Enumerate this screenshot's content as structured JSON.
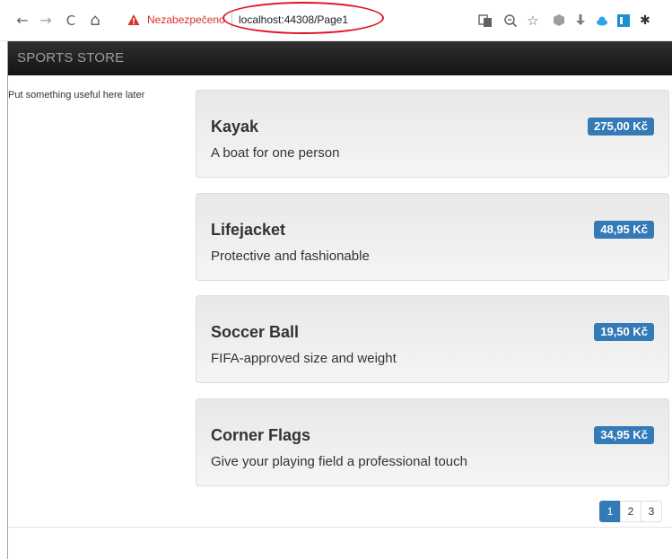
{
  "browser": {
    "back_icon": "←",
    "forward_icon": "→",
    "reload_icon": "C",
    "home_icon": "⌂",
    "security_label": "Nezabezpečeno",
    "url": "localhost:44308/Page1",
    "icons": [
      "translate-icon",
      "zoom-icon",
      "star-icon",
      "extension-icon",
      "download-icon",
      "cloud-icon",
      "profile-icon",
      "puzzle-icon"
    ],
    "annotation_color": "#e0131f"
  },
  "navbar": {
    "brand": "SPORTS STORE"
  },
  "sidebar": {
    "note": "Put something useful here later"
  },
  "products": [
    {
      "name": "Kayak",
      "description": "A boat for one person",
      "price": "275,00 Kč"
    },
    {
      "name": "Lifejacket",
      "description": "Protective and fashionable",
      "price": "48,95 Kč"
    },
    {
      "name": "Soccer Ball",
      "description": "FIFA-approved size and weight",
      "price": "19,50 Kč"
    },
    {
      "name": "Corner Flags",
      "description": "Give your playing field a professional touch",
      "price": "34,95 Kč"
    }
  ],
  "pagination": {
    "pages": [
      "1",
      "2",
      "3"
    ],
    "current": "1"
  },
  "colors": {
    "accent": "#337ab7",
    "navbar": "#222222",
    "warning": "#d93025"
  }
}
